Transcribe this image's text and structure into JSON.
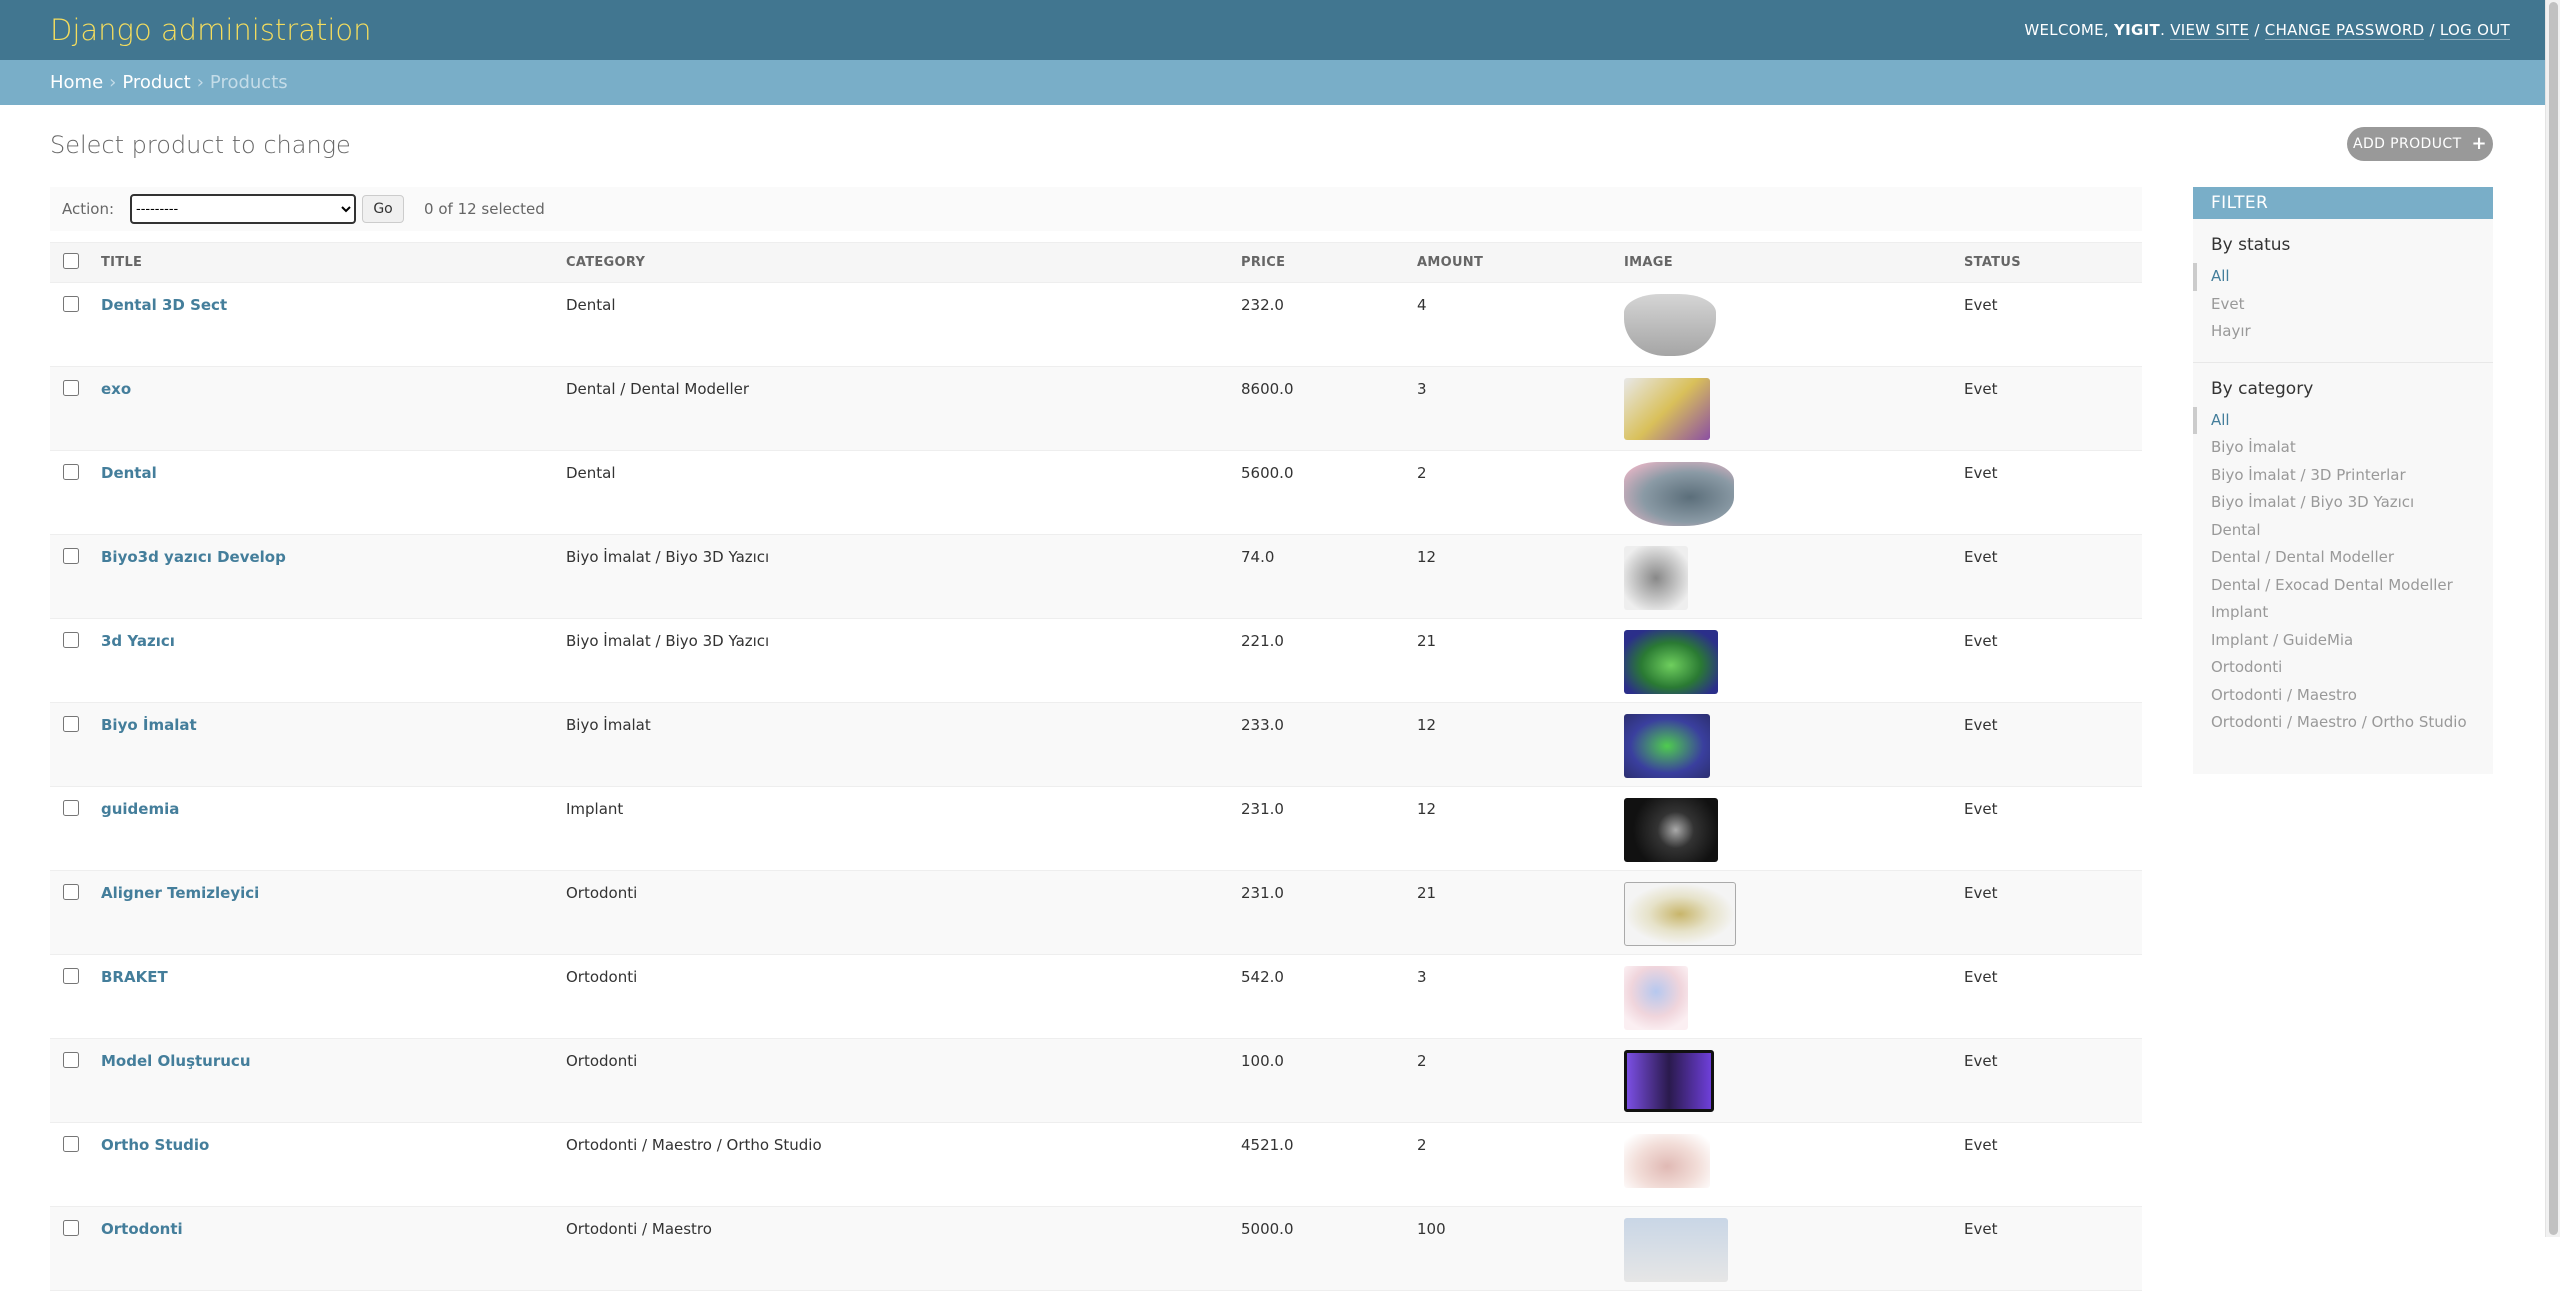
{
  "header": {
    "brand": "Django administration",
    "welcome": "WELCOME,",
    "username": "YIGIT",
    "view_site": "VIEW SITE",
    "change_password": "CHANGE PASSWORD",
    "log_out": "LOG OUT",
    "sep": "/"
  },
  "breadcrumbs": {
    "home": "Home",
    "app": "Product",
    "current": "Products"
  },
  "page": {
    "title": "Select product to change",
    "add_button": "ADD PRODUCT"
  },
  "actions": {
    "label": "Action:",
    "select_value": "---------",
    "go": "Go",
    "selected_count": "0 of 12 selected"
  },
  "table": {
    "columns": [
      "TITLE",
      "CATEGORY",
      "PRICE",
      "AMOUNT",
      "IMAGE",
      "STATUS"
    ],
    "rows": [
      {
        "title": "Dental 3D Sect",
        "category": "Dental",
        "price": "232.0",
        "amount": "4",
        "status": "Evet"
      },
      {
        "title": "exo",
        "category": "Dental / Dental Modeller",
        "price": "8600.0",
        "amount": "3",
        "status": "Evet"
      },
      {
        "title": "Dental",
        "category": "Dental",
        "price": "5600.0",
        "amount": "2",
        "status": "Evet"
      },
      {
        "title": "Biyo3d yazıcı Develop",
        "category": "Biyo İmalat / Biyo 3D Yazıcı",
        "price": "74.0",
        "amount": "12",
        "status": "Evet"
      },
      {
        "title": "3d Yazıcı",
        "category": "Biyo İmalat / Biyo 3D Yazıcı",
        "price": "221.0",
        "amount": "21",
        "status": "Evet"
      },
      {
        "title": "Biyo İmalat",
        "category": "Biyo İmalat",
        "price": "233.0",
        "amount": "12",
        "status": "Evet"
      },
      {
        "title": "guidemia",
        "category": "Implant",
        "price": "231.0",
        "amount": "12",
        "status": "Evet"
      },
      {
        "title": "Aligner Temizleyici",
        "category": "Ortodonti",
        "price": "231.0",
        "amount": "21",
        "status": "Evet"
      },
      {
        "title": "BRAKET",
        "category": "Ortodonti",
        "price": "542.0",
        "amount": "3",
        "status": "Evet"
      },
      {
        "title": "Model Oluşturucu",
        "category": "Ortodonti",
        "price": "100.0",
        "amount": "2",
        "status": "Evet"
      },
      {
        "title": "Ortho Studio",
        "category": "Ortodonti / Maestro / Ortho Studio",
        "price": "4521.0",
        "amount": "2",
        "status": "Evet"
      },
      {
        "title": "Ortodonti",
        "category": "Ortodonti / Maestro",
        "price": "5000.0",
        "amount": "100",
        "status": "Evet"
      }
    ]
  },
  "filter": {
    "title": "FILTER",
    "status": {
      "heading": "By status",
      "items": [
        "All",
        "Evet",
        "Hayır"
      ]
    },
    "category": {
      "heading": "By category",
      "items": [
        "All",
        "Biyo İmalat",
        "Biyo İmalat / 3D Printerlar",
        "Biyo İmalat / Biyo 3D Yazıcı",
        "Dental",
        "Dental / Dental Modeller",
        "Dental / Exocad Dental Modeller",
        "Implant",
        "Implant / GuideMia",
        "Ortodonti",
        "Ortodonti / Maestro",
        "Ortodonti / Maestro / Ortho Studio"
      ]
    }
  },
  "colors": {
    "header_bg": "#417690",
    "brand": "#f5dd5d",
    "breadcrumb_bg": "#79aec8",
    "link": "#447e9b"
  }
}
